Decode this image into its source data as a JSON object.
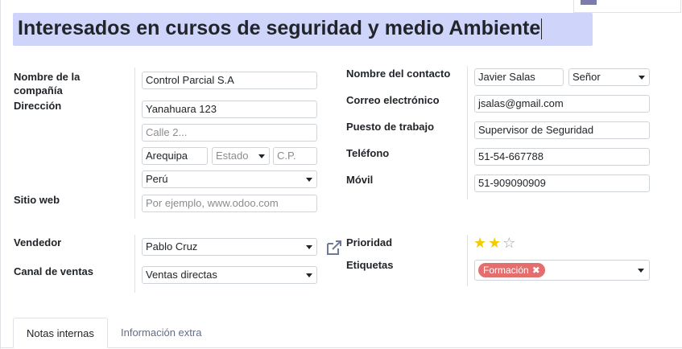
{
  "record": {
    "title": "Interesados en cursos de seguridad y medio Ambiente"
  },
  "labels": {
    "company_name": "Nombre de la compañía",
    "address": "Dirección",
    "website": "Sitio web",
    "contact_name": "Nombre del contacto",
    "email": "Correo electrónico",
    "job_position": "Puesto de trabajo",
    "phone": "Teléfono",
    "mobile": "Móvil",
    "salesperson": "Vendedor",
    "sales_channel": "Canal de ventas",
    "priority": "Prioridad",
    "tags": "Etiquetas"
  },
  "fields": {
    "company_name": "Control Parcial S.A",
    "street": "Yanahuara 123",
    "street2_placeholder": "Calle 2...",
    "city": "Arequipa",
    "state_placeholder": "Estado",
    "zip_placeholder": "C.P.",
    "country": "Perú",
    "website_placeholder": "Por ejemplo, www.odoo.com",
    "contact_name": "Javier Salas",
    "title": "Señor",
    "email": "jsalas@gmail.com",
    "job_position": "Supervisor de Seguridad",
    "phone": "51-54-667788",
    "mobile": "51-909090909",
    "salesperson": "Pablo Cruz",
    "sales_channel": "Ventas directas"
  },
  "priority": {
    "value": 2,
    "max": 3
  },
  "tags": [
    {
      "label": "Formación",
      "color": "#e46d6d"
    }
  ],
  "tabs": [
    {
      "label": "Notas internas",
      "active": true
    },
    {
      "label": "Información extra",
      "active": false
    }
  ],
  "icons": {
    "external_link": "external-link-icon",
    "star": "star-icon",
    "remove": "close-icon"
  },
  "colors": {
    "title_highlight": "#ced4fa",
    "star_on": "#f3cc00",
    "tag": "#e46d6d",
    "brand": "#7c7bad"
  }
}
